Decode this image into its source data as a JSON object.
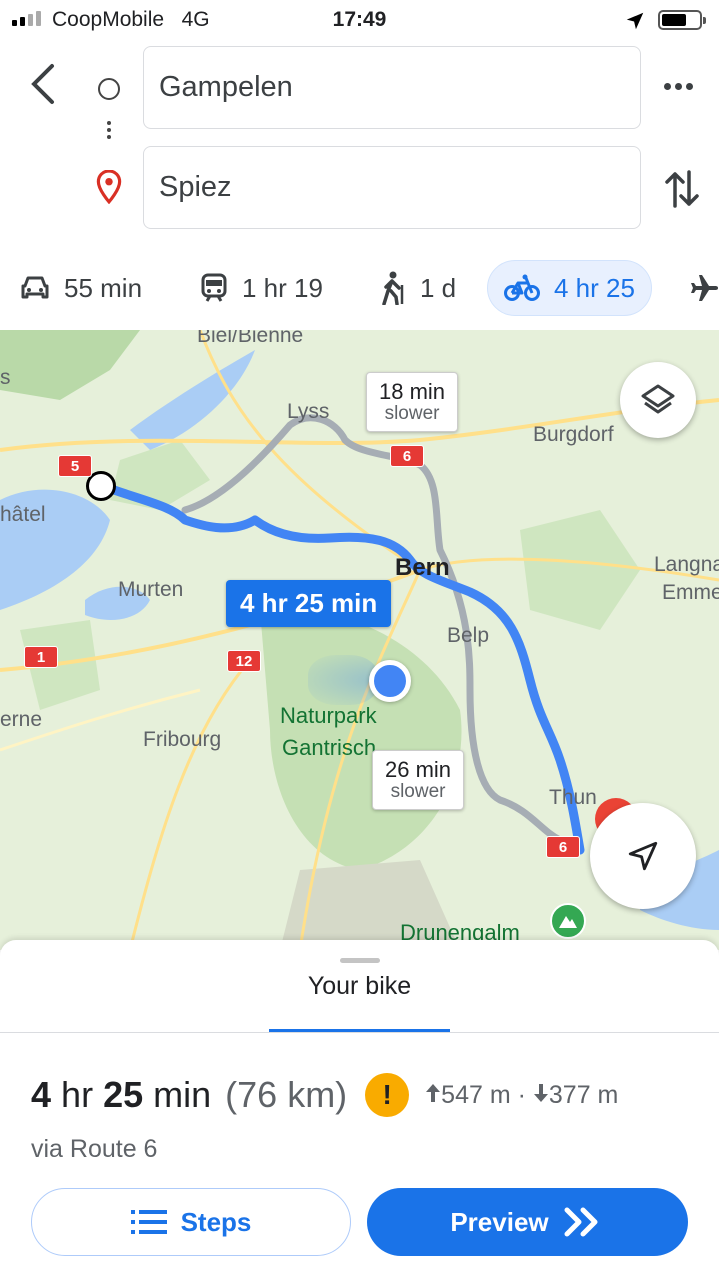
{
  "status_bar": {
    "carrier": "CoopMobile",
    "network": "4G",
    "time": "17:49"
  },
  "directions": {
    "origin": "Gampelen",
    "destination": "Spiez",
    "icons": [
      "back-arrow-icon",
      "origin-circle-icon",
      "destination-pin-icon",
      "more-icon",
      "swap-icon"
    ]
  },
  "travel_modes": [
    {
      "mode": "drive",
      "icon": "car-icon",
      "label": "55 min"
    },
    {
      "mode": "transit",
      "icon": "train-icon",
      "label": "1 hr 19"
    },
    {
      "mode": "walk",
      "icon": "walking-icon",
      "label": "1 d"
    },
    {
      "mode": "bike",
      "icon": "bike-icon",
      "label": "4 hr 25",
      "selected": true
    },
    {
      "mode": "flight",
      "icon": "plane-icon",
      "label": ""
    }
  ],
  "map": {
    "places": [
      "Biel/Bienne",
      "Lyss",
      "Burgdorf",
      "hâtel",
      "Murten",
      "Bern",
      "Belp",
      "Langna",
      "Emme",
      "erne",
      "Fribourg",
      "Naturpark",
      "Gantrisch",
      "Thun",
      "Drunengalm",
      "s"
    ],
    "road_shields": [
      "5",
      "6",
      "1",
      "12",
      "6"
    ],
    "route_label": "4 hr 25 min",
    "alternatives": [
      {
        "time": "18 min",
        "note": "slower"
      },
      {
        "time": "26 min",
        "note": "slower"
      }
    ],
    "colors": {
      "route": "#4285f4",
      "alternative": "#a6adb4",
      "route_label_bg": "#1a73e8"
    }
  },
  "sheet": {
    "tab": "Your bike",
    "duration_hours": "4",
    "hr_unit": "hr",
    "duration_minutes": "25",
    "min_unit": "min",
    "distance": "(76 km)",
    "warning_symbol": "!",
    "ascent": "547 m",
    "separator": "·",
    "descent": "377 m",
    "via": "via Route 6",
    "steps_label": "Steps",
    "preview_label": "Preview"
  }
}
